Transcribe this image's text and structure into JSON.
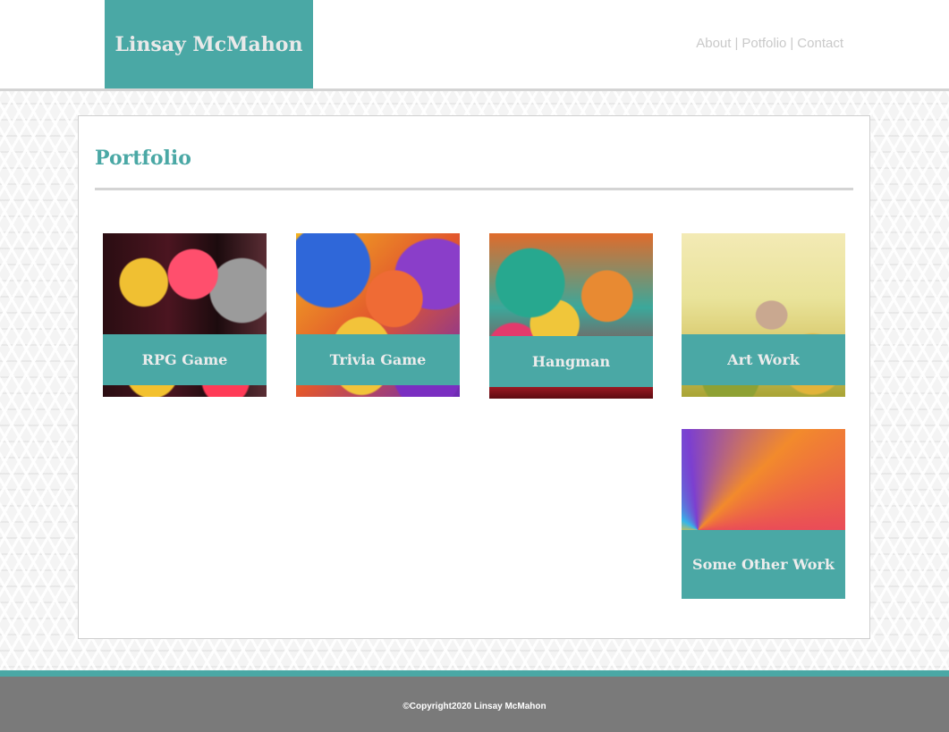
{
  "header": {
    "brand": "Linsay McMahon",
    "nav": [
      {
        "label": "About"
      },
      {
        "label": "Potfolio"
      },
      {
        "label": "Contact"
      }
    ],
    "separator": "|"
  },
  "main": {
    "title": "Portfolio",
    "cards": [
      {
        "label": "RPG Game"
      },
      {
        "label": "Trivia Game"
      },
      {
        "label": "Hangman"
      },
      {
        "label": "Art Work"
      },
      {
        "label": "Some Other Work"
      }
    ]
  },
  "footer": {
    "copyright": "©Copyright2020 Linsay McMahon"
  },
  "colors": {
    "accent": "#4aa8a5",
    "footer_bg": "#7a7a7a",
    "footer_stripe": "#4aa8a5",
    "nav_text": "#c9c9c9"
  }
}
